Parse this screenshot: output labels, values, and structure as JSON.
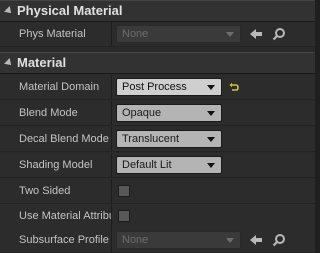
{
  "categories": [
    {
      "title": "Physical Material",
      "rows": [
        {
          "label": "Phys Material",
          "value": "None",
          "style": "dim",
          "icons": [
            "use-selected-arrow-icon",
            "browse-magnifier-icon"
          ]
        }
      ]
    },
    {
      "title": "Material",
      "rows": [
        {
          "label": "Material Domain",
          "value": "Post Process",
          "style": "light",
          "reset_icon": "reset-to-default-icon"
        },
        {
          "label": "Blend Mode",
          "value": "Opaque",
          "style": "mid"
        },
        {
          "label": "Decal Blend Mode",
          "value": "Translucent",
          "style": "mid"
        },
        {
          "label": "Shading Model",
          "value": "Default Lit",
          "style": "mid"
        },
        {
          "label": "Two Sided",
          "checkbox": false
        },
        {
          "label": "Use Material Attributes",
          "checkbox": false
        },
        {
          "label": "Subsurface Profile",
          "value": "None",
          "style": "dim",
          "icons": [
            "use-selected-arrow-icon",
            "browse-magnifier-icon"
          ]
        }
      ]
    }
  ],
  "colors": {
    "accent_reset": "#d6c12f",
    "panel_bg": "#2a2a2a",
    "header_bg": "#323232"
  }
}
